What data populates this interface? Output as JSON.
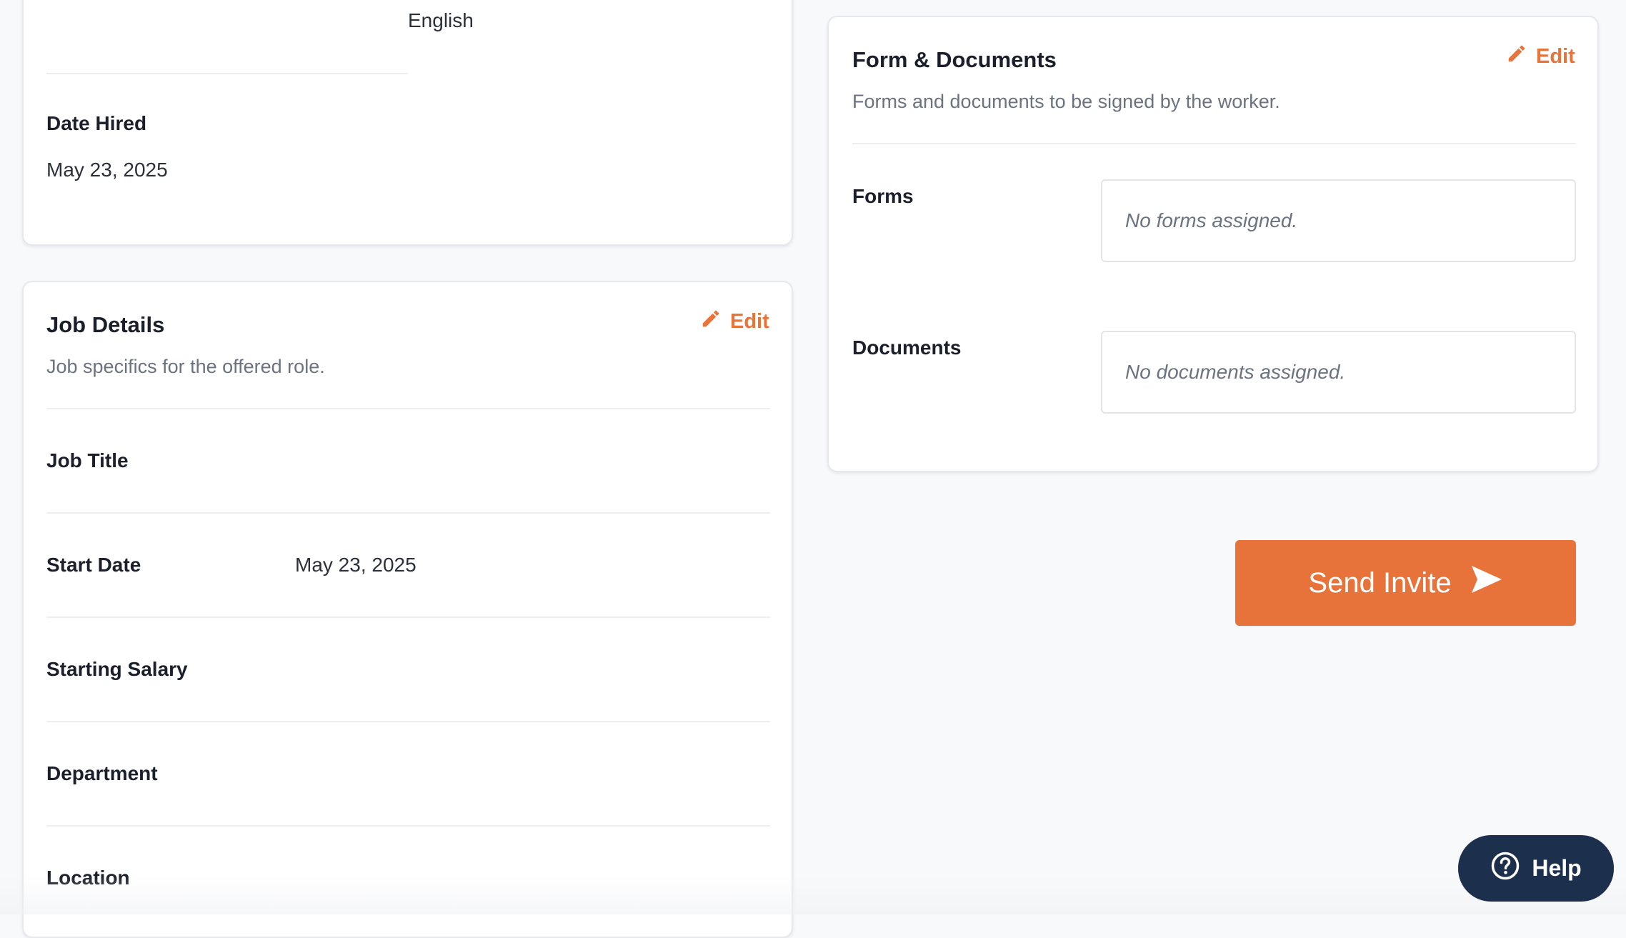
{
  "personal_card": {
    "language_value": "English",
    "date_hired_label": "Date Hired",
    "date_hired_value": "May 23, 2025"
  },
  "job_details": {
    "title": "Job Details",
    "subtitle": "Job specifics for the offered role.",
    "edit_label": "Edit",
    "fields": [
      {
        "label": "Job Title",
        "value": ""
      },
      {
        "label": "Start Date",
        "value": "May 23, 2025"
      },
      {
        "label": "Starting Salary",
        "value": ""
      },
      {
        "label": "Department",
        "value": ""
      },
      {
        "label": "Location",
        "value": ""
      }
    ]
  },
  "forms_documents": {
    "title": "Form & Documents",
    "subtitle": "Forms and documents to be signed by the worker.",
    "edit_label": "Edit",
    "forms_label": "Forms",
    "forms_empty": "No forms assigned.",
    "documents_label": "Documents",
    "documents_empty": "No documents assigned."
  },
  "actions": {
    "send_invite_label": "Send Invite",
    "help_label": "Help"
  },
  "colors": {
    "accent": "#e8733a",
    "help_bg": "#1c2f4d",
    "page_bg": "#f8f9fb"
  },
  "icons": {
    "edit": "pencil-icon",
    "send": "paper-plane-icon",
    "help": "question-circle-icon"
  }
}
